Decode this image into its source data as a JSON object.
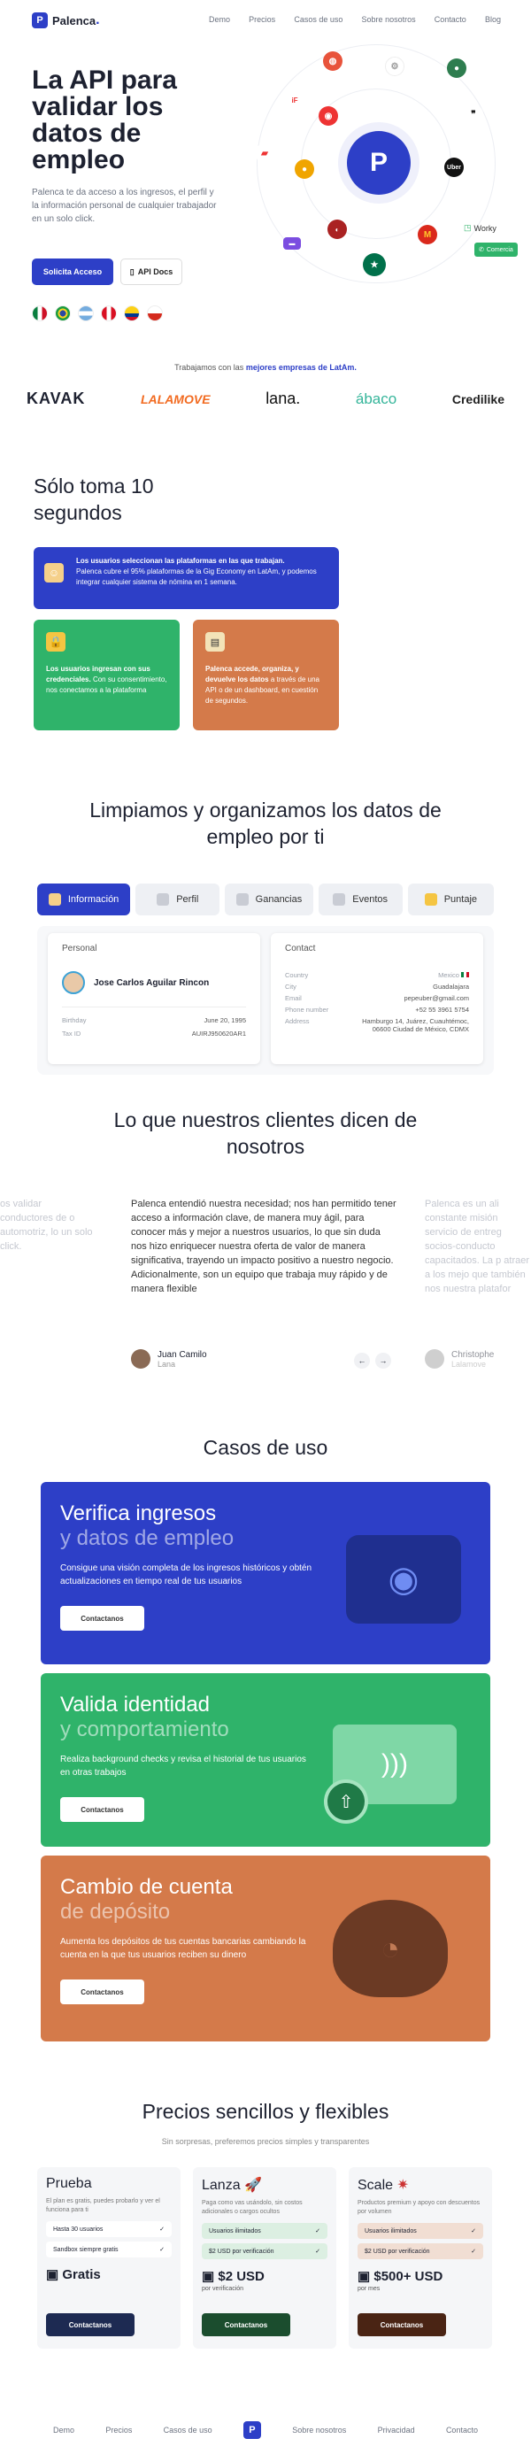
{
  "brand": {
    "name": "Palenca",
    "dot": ".",
    "logo_letter": "P",
    "accent": "#2d3fc7",
    "green": "#2fb36a",
    "orange": "#d47a4a"
  },
  "nav": {
    "items": [
      "Demo",
      "Precios",
      "Casos de uso",
      "Sobre nosotros",
      "Contacto",
      "Blog"
    ]
  },
  "hero": {
    "title": "La API para validar los datos de empleo",
    "subtitle": "Palenca te da acceso a los ingresos, el perfil y la información personal de cualquier trabajador en un solo click.",
    "cta": "Solicita Acceso",
    "docs": "API Docs",
    "worky": "Worky",
    "comercia": "Comercia",
    "badge_logo": "P",
    "uber": "Uber"
  },
  "partners": {
    "caption_pre": "Trabajamos con las ",
    "caption_bold": "mejores empresas de LatAm.",
    "logos": [
      "KAVAK",
      "LALAMOVE",
      "lana.",
      "ábaco",
      "Credilike"
    ]
  },
  "steps": {
    "title": "Sólo toma 10 segundos",
    "s1_title": "Los usuarios seleccionan las plataformas en las que trabajan.",
    "s1_text": "Palenca cubre el 95% plataformas de la Gig Economy en LatAm, y podemos integrar cualquier sistema de nómina en 1 semana.",
    "s2_title": "Los usuarios ingresan con sus credenciales.",
    "s2_text": "Con su consentimiento, nos conectamos a la plataforma",
    "s3_title": "Palenca accede, organiza, y devuelve los datos",
    "s3_text": "a través de una API o de un dashboard, en cuestión de segundos."
  },
  "data_section": {
    "title": "Limpiamos y organizamos los datos de empleo por ti",
    "tabs": [
      "Información",
      "Perfil",
      "Ganancias",
      "Eventos",
      "Puntaje"
    ],
    "personal_label": "Personal",
    "name": "Jose Carlos Aguilar Rincon",
    "birthday_k": "Birthday",
    "birthday_v": "June 20, 1995",
    "tax_k": "Tax ID",
    "tax_v": "AUIRJ950620AR1",
    "contact_label": "Contact",
    "country_k": "Country",
    "country_v": "Mexico",
    "city_k": "City",
    "city_v": "Guadalajara",
    "email_k": "Email",
    "email_v": "pepeuber@gmail.com",
    "phone_k": "Phone number",
    "phone_v": "+52 55 3961 5754",
    "address_k": "Address",
    "address_v": "Hamburgo 14, Juárez, Cuauhtémoc, 06600 Ciudad de México, CDMX"
  },
  "testimonials": {
    "title": "Lo que nuestros clientes dicen de nosotros",
    "left_partial": "os validar conductores de o automotriz, lo un solo click.",
    "quote": "Palenca entendió nuestra necesidad; nos han permitido tener acceso a información clave, de manera muy ágil, para conocer más y mejor a nuestros usuarios, lo que sin duda nos hizo enriquecer nuestra oferta de valor de manera significativa, trayendo un impacto positivo a nuestro negocio. Adicionalmente, son un equipo que trabaja muy rápido y de manera flexible",
    "right_partial": "Palenca es un ali constante misión servicio de entreg socios-conducto capacitados. La p atraer a los mejo que también nos nuestra platafor",
    "author": "Juan Camilo",
    "company": "Lana",
    "author2": "Christophe",
    "company2": "Lalamove",
    "prev": "←",
    "next": "→"
  },
  "cases": {
    "title": "Casos de uso",
    "c1_a": "Verifica ingresos",
    "c1_b": "y datos de empleo",
    "c1_text": "Consigue una visión completa de los ingresos históricos y obtén actualizaciones en tiempo real de tus usuarios",
    "c2_a": "Valida identidad",
    "c2_b": "y comportamiento",
    "c2_text": "Realiza background checks y revisa el historial de tus usuarios en otras trabajos",
    "c3_a": "Cambio de cuenta",
    "c3_b": "de depósito",
    "c3_text": "Aumenta los depósitos de tus cuentas bancarias cambiando la cuenta en la que tus usuarios reciben su dinero",
    "cta": "Contactanos"
  },
  "pricing": {
    "title": "Precios sencillos y flexibles",
    "subtitle": "Sin sorpresas, preferemos precios simples y transparentes",
    "p1": {
      "name": "Prueba",
      "desc": "El plan es gratis, puedes probarlo y ver el funciona para ti",
      "f1": "Hasta 30 usuarios",
      "f2": "Sandbox siempre gratis",
      "amount": "Gratis",
      "per": "",
      "cta": "Contactanos"
    },
    "p2": {
      "name": "Lanza",
      "desc": "Paga como vas usándolo, sin costos adicionales o cargos ocultos",
      "f1": "Usuarios ilimitados",
      "f2": "$2 USD por verificación",
      "amount": "$2 USD",
      "per": "por verificación",
      "cta": "Contactanos"
    },
    "p3": {
      "name": "Scale",
      "desc": "Productos premium y apoyo con descuentos por volumen",
      "f1": "Usuarios ilimitados",
      "f2": "$2 USD por verificación",
      "amount": "$500+ USD",
      "per": "por mes",
      "cta": "Contactanos"
    }
  },
  "footer": {
    "items": [
      "Demo",
      "Precios",
      "Casos de uso",
      "Sobre nosotros",
      "Privacidad",
      "Contacto"
    ],
    "logo": "P"
  }
}
